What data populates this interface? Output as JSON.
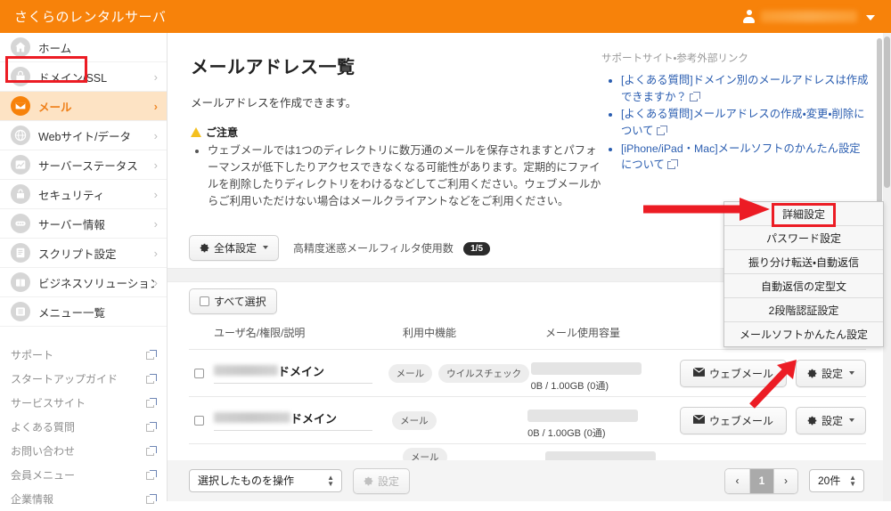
{
  "header": {
    "brand": "さくらのレンタルサーバ",
    "user_icon": "user-icon",
    "user_name": "",
    "caret": "chevron-down-icon"
  },
  "sidebar": {
    "items": [
      {
        "label": "ホーム",
        "icon": "home-icon",
        "chevron": "",
        "active": false
      },
      {
        "label": "ドメイン/SSL",
        "icon": "lock-domain-icon",
        "chevron": "›",
        "active": false
      },
      {
        "label": "メール",
        "icon": "mail-icon",
        "chevron": "›",
        "active": true
      },
      {
        "label": "Webサイト/データ",
        "icon": "globe-icon",
        "chevron": "›",
        "active": false
      },
      {
        "label": "サーバーステータス",
        "icon": "chart-icon",
        "chevron": "›",
        "active": false
      },
      {
        "label": "セキュリティ",
        "icon": "padlock-icon",
        "chevron": "›",
        "active": false
      },
      {
        "label": "サーバー情報",
        "icon": "server-icon",
        "chevron": "›",
        "active": false
      },
      {
        "label": "スクリプト設定",
        "icon": "script-icon",
        "chevron": "›",
        "active": false
      },
      {
        "label": "ビジネスソリューション",
        "icon": "briefcase-icon",
        "chevron": "›",
        "active": false
      },
      {
        "label": "メニュー一覧",
        "icon": "list-icon",
        "chevron": "",
        "active": false
      }
    ],
    "external_links": [
      {
        "label": "サポート",
        "icon": "external-link-icon"
      },
      {
        "label": "スタートアップガイド",
        "icon": "external-link-icon"
      },
      {
        "label": "サービスサイト",
        "icon": "external-link-icon"
      },
      {
        "label": "よくある質問",
        "icon": "external-link-icon"
      },
      {
        "label": "お問い合わせ",
        "icon": "external-link-icon"
      },
      {
        "label": "会員メニュー",
        "icon": "external-link-icon"
      },
      {
        "label": "企業情報",
        "icon": "external-link-icon"
      }
    ]
  },
  "page": {
    "title": "メールアドレス一覧",
    "description": "メールアドレスを作成できます。",
    "notice_icon": "warning-triangle-icon",
    "notice_title": "ご注意",
    "notice_items": [
      "ウェブメールでは1つのディレクトリに数万通のメールを保存されますとパフォーマンスが低下したりアクセスできなくなる可能性があります。定期的にファイルを削除したりディレクトリをわけるなどしてご利用ください。ウェブメールからご利用いただけない場合はメールクライアントなどをご利用ください。"
    ]
  },
  "support": {
    "heading": "サポートサイト・参考外部リンク",
    "links": [
      {
        "text": "[よくある質問]ドメイン別のメールアドレスは作成できますか？",
        "icon": "external-link-icon"
      },
      {
        "text": "[よくある質問]メールアドレスの作成・変更・削除について",
        "icon": "external-link-icon"
      },
      {
        "text": "[iPhone/iPad・Mac]メールソフトのかんたん設定について",
        "icon": "external-link-icon"
      }
    ]
  },
  "toolbar": {
    "global_settings_label": "全体設定",
    "global_settings_icon": "gear-icon",
    "global_settings_caret": "chevron-down-icon",
    "spam_filter_label": "高精度迷惑メールフィルタ使用数",
    "spam_filter_count": "1/5"
  },
  "select_all": {
    "label": "すべて選択",
    "checkbox_checked": false
  },
  "table": {
    "columns": [
      "ユーザ名/権限/説明",
      "利用中機能",
      "メール使用容量",
      ""
    ],
    "rows": [
      {
        "checkbox_checked": false,
        "name_blurred": true,
        "name_suffix": "ドメイン",
        "features": [
          "メール",
          "ウイルスチェック"
        ],
        "capacity_text": "0B / 1.00GB (0通)",
        "webmail_label": "ウェブメール",
        "webmail_icon": "envelope-icon",
        "settings_label": "設定",
        "settings_icon": "gear-icon",
        "settings_caret": "chevron-down-icon"
      },
      {
        "checkbox_checked": false,
        "name_blurred": true,
        "name_suffix": "ドメイン",
        "features": [
          "メール"
        ],
        "capacity_text": "0B / 1.00GB (0通)",
        "webmail_label": "ウェブメール",
        "webmail_icon": "envelope-icon",
        "settings_label": "設定",
        "settings_icon": "gear-icon",
        "settings_caret": "chevron-down-icon"
      },
      {
        "checkbox_checked": false,
        "name_blurred": true,
        "name_suffix": "",
        "features": [
          "メール"
        ],
        "capacity_text": "",
        "webmail_label": "",
        "webmail_icon": "envelope-icon",
        "settings_label": "",
        "settings_icon": "gear-icon",
        "settings_caret": ""
      }
    ]
  },
  "dropdown": {
    "items": [
      {
        "label": "詳細設定",
        "highlighted": true
      },
      {
        "label": "パスワード設定",
        "highlighted": false
      },
      {
        "label": "振り分け転送・自動返信",
        "highlighted": false
      },
      {
        "label": "自動返信の定型文",
        "highlighted": false
      },
      {
        "label": "2段階認証設定",
        "highlighted": false
      },
      {
        "label": "メールソフトかんたん設定",
        "highlighted": false
      }
    ]
  },
  "bottom": {
    "bulk_select_value": "選択したものを操作",
    "bulk_apply_label": "設定",
    "bulk_apply_icon": "gear-icon",
    "pager": {
      "prev": "‹",
      "current_page": "1",
      "next": "›",
      "per_page_value": "20件"
    }
  },
  "annotations": {
    "arrow_color": "#ec1c24",
    "highlight_color": "#ec1c24",
    "arrows": [
      "arrow-to-detail-settings",
      "arrow-to-row-settings-button"
    ]
  },
  "colors": {
    "brand_orange": "#f7820a",
    "active_nav_bg": "#fde3c4",
    "active_nav_text": "#ef7f18",
    "link_blue": "#2a5db0",
    "page_bg": "#f4f4f4",
    "warning_yellow": "#f4c01f"
  }
}
